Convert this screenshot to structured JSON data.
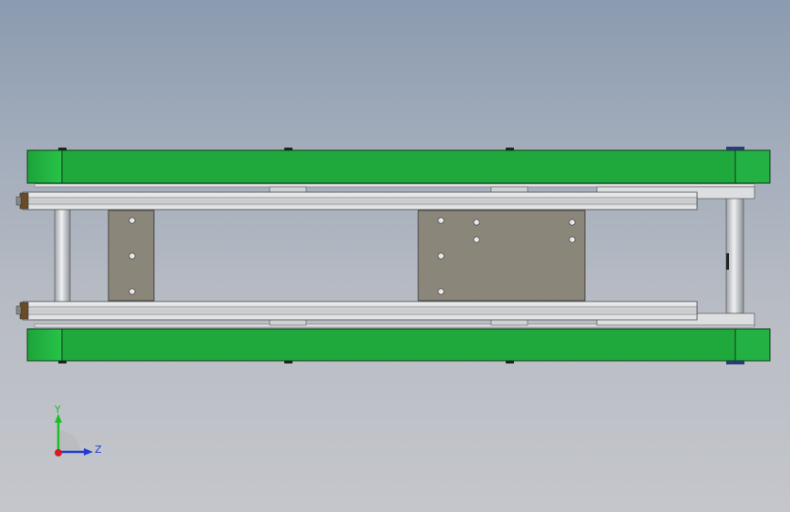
{
  "view": {
    "background_top": "#8b9bb0",
    "background_bottom": "#c4c6cb"
  },
  "model": {
    "belt_color": "#1fa83c",
    "belt_dark": "#146e27",
    "plate_color": "#8a877a",
    "rail_color": "#d8dadd",
    "roller_color": "#c9cbd0"
  },
  "triad": {
    "y_label": "Y",
    "z_label": "Z",
    "y_color": "#1bbf2a",
    "z_color": "#1e3ccf",
    "x_color": "#d21e1e"
  }
}
